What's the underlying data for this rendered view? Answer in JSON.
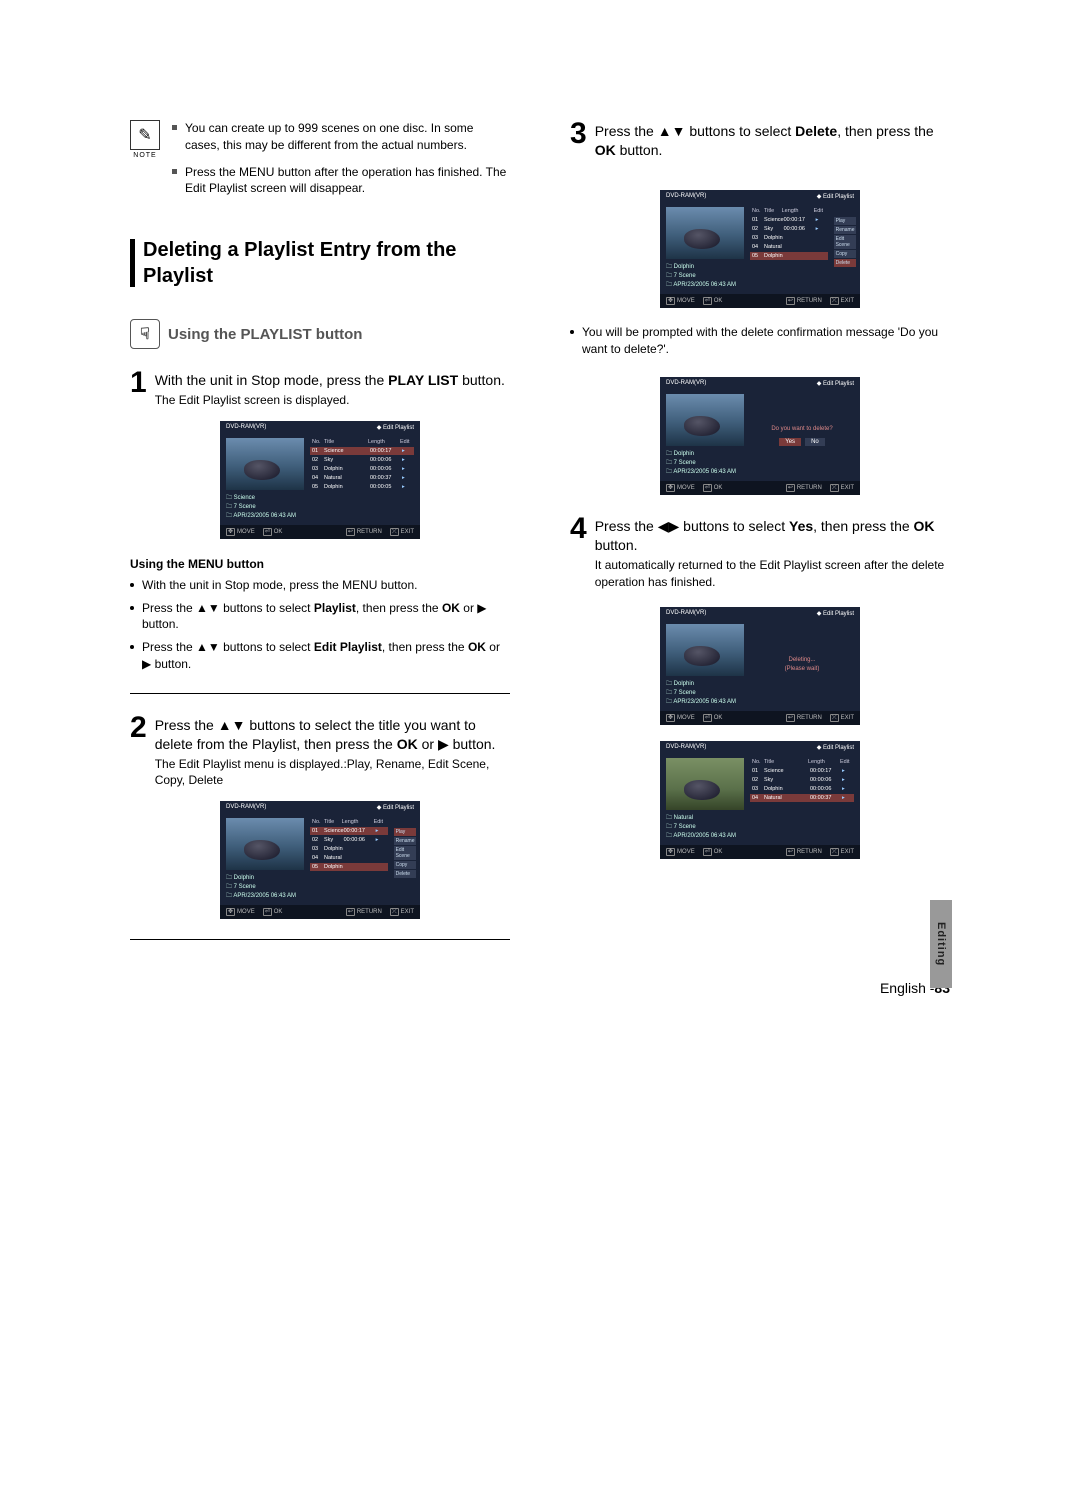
{
  "note": {
    "label": "NOTE",
    "items": [
      "You can create up to 999 scenes on one disc. In some cases, this may be different from the actual numbers.",
      "Press the MENU button after the operation has finished. The Edit Playlist screen will disappear."
    ]
  },
  "section_heading": "Deleting a Playlist Entry from the Playlist",
  "subheading": "Using the PLAYLIST button",
  "steps": {
    "s1": {
      "num": "1",
      "instruction_pre": "With the unit in Stop mode, press the ",
      "instruction_bold": "PLAY LIST",
      "instruction_post": " button.",
      "subtext": "The Edit Playlist screen is displayed."
    },
    "menu_heading": "Using the MENU button",
    "menu_bullets": {
      "b1": "With the unit in Stop mode, press the MENU button.",
      "b2_pre": "Press the ",
      "b2_sym": "▲▼",
      "b2_mid": " buttons to select ",
      "b2_bold": "Playlist",
      "b2_mid2": ", then press the ",
      "b2_bold2": "OK",
      "b2_mid3": " or ",
      "b2_sym2": "▶",
      "b2_post": " button.",
      "b3_pre": "Press the ",
      "b3_sym": "▲▼",
      "b3_mid": " buttons to select ",
      "b3_bold": "Edit Playlist",
      "b3_mid2": ", then press the ",
      "b3_bold2": "OK",
      "b3_mid3": " or ",
      "b3_sym2": "▶",
      "b3_post": " button."
    },
    "s2": {
      "num": "2",
      "instruction_pre": "Press the ",
      "instruction_sym": "▲▼",
      "instruction_mid": " buttons to select the title you want to delete from the Playlist, then press the ",
      "instruction_bold": "OK",
      "instruction_mid2": " or ",
      "instruction_sym2": "▶",
      "instruction_post": " button.",
      "subtext": "The Edit Playlist menu is displayed.:Play, Rename, Edit Scene, Copy, Delete"
    },
    "s3": {
      "num": "3",
      "instruction_pre": "Press the ",
      "instruction_sym": "▲▼",
      "instruction_mid": " buttons to select ",
      "instruction_bold": "Delete",
      "instruction_mid2": ", then press the ",
      "instruction_bold2": "OK",
      "instruction_post": " button."
    },
    "s3note": "You will be prompted with the delete confirmation message 'Do you want to delete?'.",
    "s4": {
      "num": "4",
      "instruction_pre": "Press the ",
      "instruction_sym": "◀▶",
      "instruction_mid": " buttons to select ",
      "instruction_bold": "Yes",
      "instruction_mid2": ", then press the ",
      "instruction_bold2": "OK",
      "instruction_post": " button.",
      "subtext": "It automatically returned to the Edit Playlist screen after the delete operation has finished."
    }
  },
  "osd": {
    "header_left": "DVD-RAM(VR)",
    "header_right": "Edit Playlist",
    "thumb_info_line1_science": "Science",
    "thumb_info_line1_dolphin": "Dolphin",
    "thumb_info_line1_natural": "Natural",
    "thumb_info_line2": "7 Scene",
    "thumb_info_line3": "APR/23/2005 06:43 AM",
    "thumb_info_line3b": "APR/20/2005 06:43 AM",
    "list_header": {
      "no": "No.",
      "title": "Title",
      "length": "Length",
      "edit": "Edit"
    },
    "rows5": [
      {
        "no": "01",
        "title": "Science",
        "length": "00:00:17"
      },
      {
        "no": "02",
        "title": "Sky",
        "length": "00:00:06"
      },
      {
        "no": "03",
        "title": "Dolphin",
        "length": "00:00:06"
      },
      {
        "no": "04",
        "title": "Natural",
        "length": "00:00:37"
      },
      {
        "no": "05",
        "title": "Dolphin",
        "length": "00:00:05"
      }
    ],
    "rows4": [
      {
        "no": "01",
        "title": "Science",
        "length": "00:00:17"
      },
      {
        "no": "02",
        "title": "Sky",
        "length": "00:00:06"
      },
      {
        "no": "03",
        "title": "Dolphin",
        "length": "00:00:06"
      },
      {
        "no": "04",
        "title": "Natural",
        "length": "00:00:37"
      }
    ],
    "popup": [
      "Play",
      "Rename",
      "Edit Scene",
      "Copy",
      "Delete"
    ],
    "confirm_msg": "Do you want to delete?",
    "yes": "Yes",
    "no": "No",
    "deleting": "Deleting...",
    "please_wait": "(Please wait)",
    "footer": {
      "move": "MOVE",
      "ok": "OK",
      "return": "RETURN",
      "exit": "EXIT"
    }
  },
  "side_tab": "Editing",
  "footer_text": "English -",
  "page_num": "83"
}
